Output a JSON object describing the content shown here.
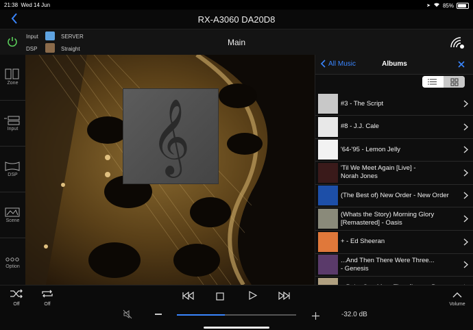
{
  "status_bar": {
    "time": "21:38",
    "date": "Wed 14 Jun",
    "battery": "85%",
    "battery_level": 0.85
  },
  "header": {
    "title": "RX-A3060 DA20D8"
  },
  "info_bar": {
    "input_label": "Input",
    "input_value": "SERVER",
    "dsp_label": "DSP",
    "dsp_value": "Straight",
    "zone_name": "Main"
  },
  "sidebar": {
    "items": [
      {
        "label": "Zone"
      },
      {
        "label": "Input"
      },
      {
        "label": "DSP"
      },
      {
        "label": "Scene"
      },
      {
        "label": "Option"
      }
    ]
  },
  "panel": {
    "back_label": "All Music",
    "title": "Albums",
    "albums": [
      {
        "title": "#3 - The Script",
        "color": "#c8c8c8"
      },
      {
        "title": "#8 - J.J. Cale",
        "color": "#e8e8e8"
      },
      {
        "title": "'64-'95 - Lemon Jelly",
        "color": "#f2f2f2"
      },
      {
        "title": "'Til We Meet Again [Live] -\nNorah Jones",
        "color": "#3a1a1a"
      },
      {
        "title": "(The Best of) New Order - New Order",
        "color": "#1d4fa8"
      },
      {
        "title": "(Whats the Story) Morning Glory\n[Remastered] - Oasis",
        "color": "#8a8a7a"
      },
      {
        "title": "+ - Ed Sheeran",
        "color": "#e0783a"
      },
      {
        "title": "...And Then There Were Three...\n- Genesis",
        "color": "#5a3a6a"
      },
      {
        "title": "...Baby One More Time [Import Bonus",
        "color": "#b0a080"
      }
    ]
  },
  "bottom": {
    "shuffle_label": "Off",
    "repeat_label": "Off",
    "volume_label": "Volume",
    "volume_value": "-32.0 dB",
    "volume_level": 0.4
  },
  "colors": {
    "accent": "#3a86ff",
    "text": "#f0f0f0"
  }
}
